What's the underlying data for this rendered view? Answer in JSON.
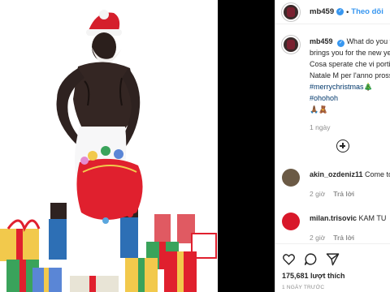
{
  "post": {
    "username": "mb459",
    "follow_label": "Theo dõi",
    "caption_lines": [
      "What do you think Santa",
      "brings you for the new year?",
      "Cosa sperate che vi porti",
      "Natale M per l'anno prossimo"
    ],
    "hashtags": [
      "#merrychristmas🎄",
      "#ohohoh"
    ],
    "caption_emoji": "🙏🏾🧸",
    "caption_time": "1 ngày"
  },
  "comments": [
    {
      "user": "akin_ozdeniz11",
      "text": "Come to",
      "time": "2 giờ",
      "reply": "Trả lời"
    },
    {
      "user": "milan.trisovic",
      "text": "KAM TU",
      "time": "2 giờ",
      "reply": "Trả lời"
    }
  ],
  "footer": {
    "likes": "175,681 lượt thích",
    "date": "1 NGÀY TRƯỚC"
  },
  "icons": [
    "heart-icon",
    "comment-icon",
    "share-icon",
    "add-comment-icon"
  ],
  "colors": {
    "link": "#3897f0",
    "hashtag": "#00376b",
    "muted": "#8e8e8e",
    "santa_red": "#e0202e"
  }
}
